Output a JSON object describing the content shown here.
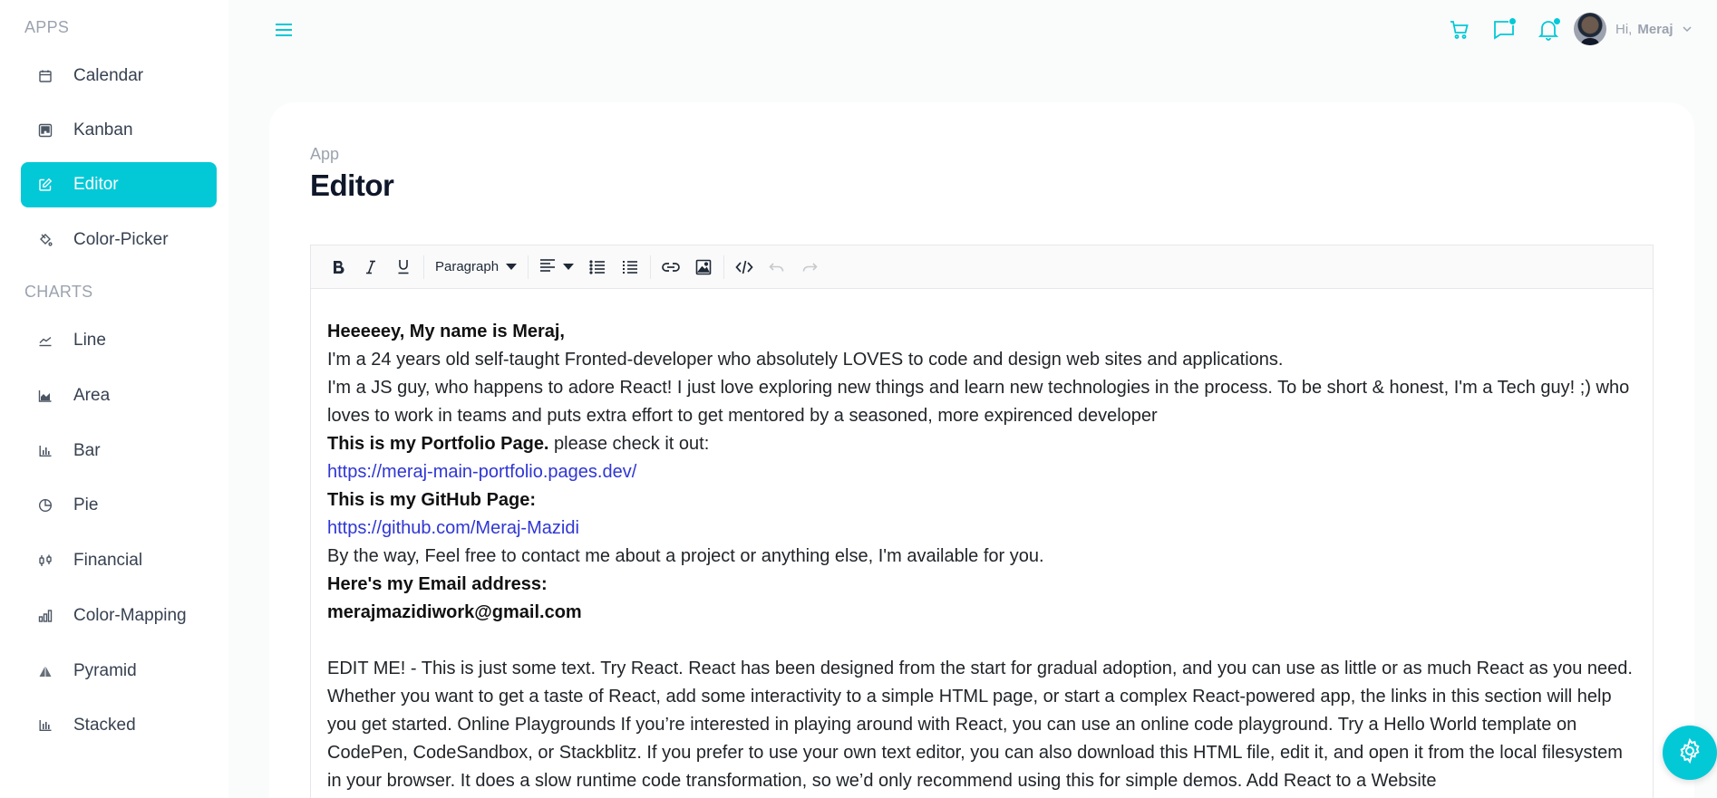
{
  "sidebar": {
    "sections": [
      {
        "title": "APPS",
        "items": [
          {
            "label": "Calendar",
            "icon": "calendar-icon"
          },
          {
            "label": "Kanban",
            "icon": "kanban-icon"
          },
          {
            "label": "Editor",
            "icon": "edit-icon",
            "active": true
          },
          {
            "label": "Color-Picker",
            "icon": "bucket-icon"
          }
        ]
      },
      {
        "title": "CHARTS",
        "items": [
          {
            "label": "Line",
            "icon": "line-chart-icon"
          },
          {
            "label": "Area",
            "icon": "area-chart-icon"
          },
          {
            "label": "Bar",
            "icon": "bar-chart-icon"
          },
          {
            "label": "Pie",
            "icon": "pie-chart-icon"
          },
          {
            "label": "Financial",
            "icon": "financial-icon"
          },
          {
            "label": "Color-Mapping",
            "icon": "color-mapping-icon"
          },
          {
            "label": "Pyramid",
            "icon": "pyramid-icon"
          },
          {
            "label": "Stacked",
            "icon": "stacked-chart-icon"
          }
        ]
      }
    ]
  },
  "header": {
    "greeting": "Hi,",
    "user_name": "Meraj",
    "icons": [
      "menu-icon",
      "cart-icon",
      "chat-icon",
      "bell-icon"
    ],
    "accent": "#03c9d7"
  },
  "page": {
    "breadcrumb": "App",
    "title": "Editor"
  },
  "editor": {
    "toolbar": {
      "paragraph_label": "Paragraph"
    },
    "content": {
      "heading": "Heeeeey, My name is Meraj,",
      "line1": "I'm a 24 years old self-taught Fronted-developer who absolutely LOVES to code and design web sites and applications.",
      "line2": "I'm a JS guy, who happens to adore React! I just love exploring new things and learn new technologies in the process. To be short & honest, I'm a Tech guy! ;) who loves to work in teams and puts extra effort to get mentored by a seasoned, more expirenced developer",
      "portfolio_bold": "This is my Portfolio Page.",
      "portfolio_rest": " please check it out:",
      "portfolio_link": "https://meraj-main-portfolio.pages.dev/",
      "github_bold": "This is my GitHub Page:",
      "github_link": "https://github.com/Meraj-Mazidi",
      "contact": "By the way, Feel free to contact me about a project or anything else, I'm available for you.",
      "email_label": "Here's my Email address:",
      "email": "merajmazidiwork@gmail.com",
      "edit_text": "EDIT ME! - This is just some text. Try React. React has been designed from the start for gradual adoption, and you can use as little or as much React as you need. Whether you want to get a taste of React, add some interactivity to a simple HTML page, or start a complex React-powered app, the links in this section will help you get started. Online Playgrounds If you’re interested in playing around with React, you can use an online code playground. Try a Hello World template on CodePen, CodeSandbox, or Stackblitz. If you prefer to use your own text editor, you can also download this HTML file, edit it, and open it from the local filesystem in your browser. It does a slow runtime code transformation, so we’d only recommend using this for simple demos. Add React to a Website"
    }
  }
}
